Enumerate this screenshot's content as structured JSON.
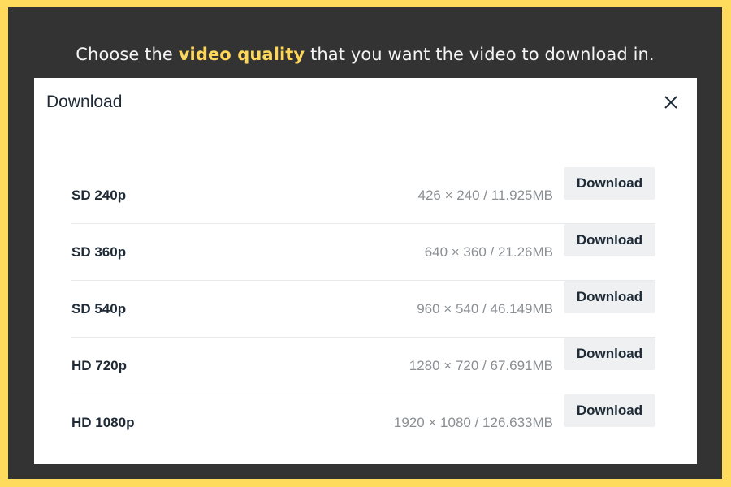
{
  "caption": {
    "before": "Choose the ",
    "highlight": "video quality",
    "after": " that you want the video to download in.",
    "highlight_color": "#fdd65a"
  },
  "modal": {
    "title": "Download",
    "close_icon": "close-icon",
    "options": [
      {
        "label": "SD 240p",
        "info": "426 × 240 / 11.925MB",
        "button": "Download"
      },
      {
        "label": "SD 360p",
        "info": "640 × 360 / 21.26MB",
        "button": "Download"
      },
      {
        "label": "SD 540p",
        "info": "960 × 540 / 46.149MB",
        "button": "Download"
      },
      {
        "label": "HD 720p",
        "info": "1280 × 720 / 67.691MB",
        "button": "Download"
      },
      {
        "label": "HD 1080p",
        "info": "1920 × 1080 / 126.633MB",
        "button": "Download"
      }
    ]
  },
  "colors": {
    "border": "#fedb5c",
    "background": "#333333",
    "button_bg": "#eef0f2"
  }
}
